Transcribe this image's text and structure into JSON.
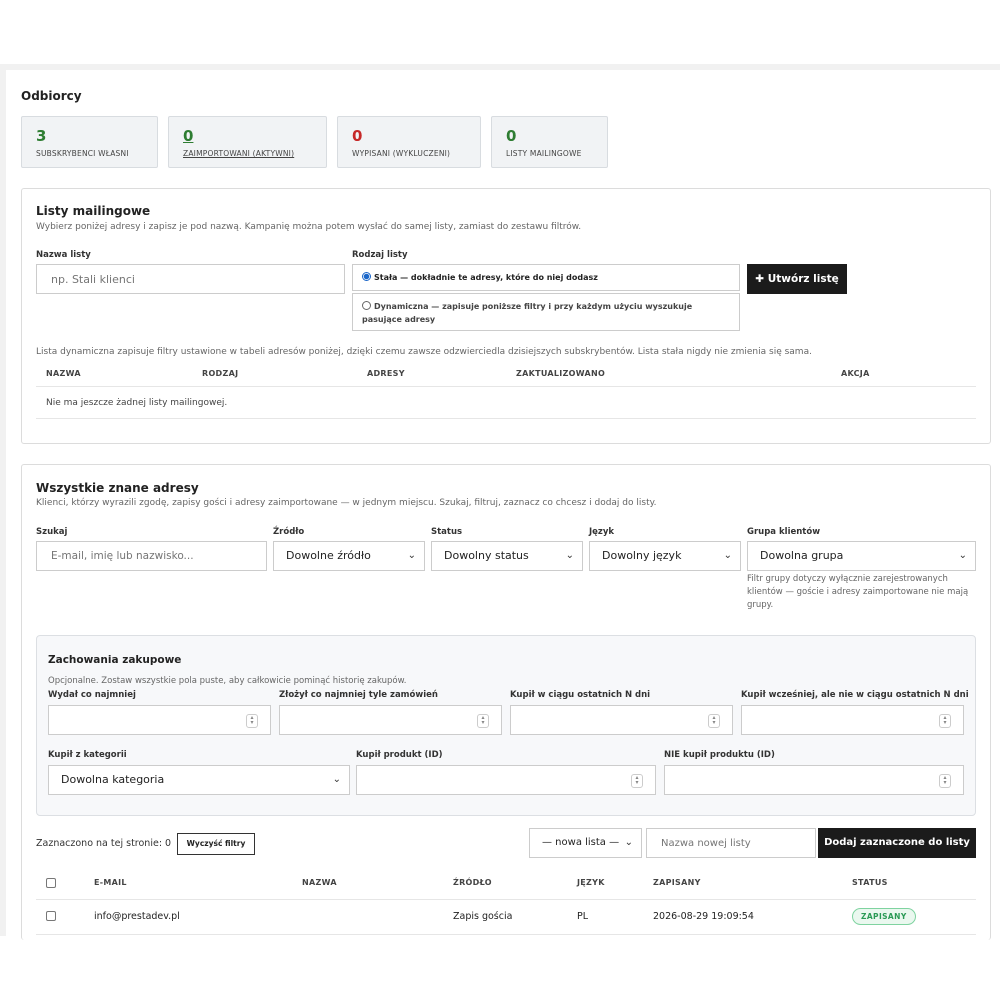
{
  "recipients": {
    "title": "Odbiorcy",
    "stats": [
      {
        "value": "3",
        "label": "SUBSKRYBENCI WŁASNI",
        "color": "#2e7d32"
      },
      {
        "value": "0",
        "label": "ZAIMPORTOWANI (AKTYWNI)",
        "color": "#2e7d32"
      },
      {
        "value": "0",
        "label": "WYPISANI (WYKLUCZENI)",
        "color": "#c62828"
      },
      {
        "value": "0",
        "label": "LISTY MAILINGOWE",
        "color": "#2e7d32"
      }
    ]
  },
  "mailing_lists": {
    "title": "Listy mailingowe",
    "subtitle": "Wybierz poniżej adresy i zapisz je pod nazwą. Kampanię można potem wysłać do samej listy, zamiast do zestawu filtrów.",
    "name_label": "Nazwa listy",
    "name_placeholder": "np. Stali klienci",
    "type_label": "Rodzaj listy",
    "type_static": "Stała — dokładnie te adresy, które do niej dodasz",
    "type_dynamic": "Dynamiczna — zapisuje poniższe filtry i przy każdym użyciu wyszukuje pasujące adresy",
    "create_button": "Utwórz listę",
    "info": "Lista dynamiczna zapisuje filtry ustawione w tabeli adresów poniżej, dzięki czemu zawsze odzwierciedla dzisiejszych subskrybentów. Lista stała nigdy nie zmienia się sama.",
    "columns": [
      "NAZWA",
      "RODZAJ",
      "ADRESY",
      "ZAKTUALIZOWANO",
      "AKCJA"
    ],
    "empty": "Nie ma jeszcze żadnej listy mailingowej."
  },
  "addresses": {
    "title": "Wszystkie znane adresy",
    "subtitle": "Klienci, którzy wyrazili zgodę, zapisy gości i adresy zaimportowane — w jednym miejscu. Szukaj, filtruj, zaznacz co chcesz i dodaj do listy.",
    "search_label": "Szukaj",
    "search_placeholder": "E-mail, imię lub nazwisko...",
    "source_label": "Źródło",
    "source_value": "Dowolne źródło",
    "status_label": "Status",
    "status_value": "Dowolny status",
    "language_label": "Język",
    "language_value": "Dowolny język",
    "group_label": "Grupa klientów",
    "group_value": "Dowolna grupa",
    "group_hint": "Filtr grupy dotyczy wyłącznie zarejestrowanych klientów — goście i adresy zaimportowane nie mają grupy.",
    "purchase": {
      "title": "Zachowania zakupowe",
      "subtitle": "Opcjonalne. Zostaw wszystkie pola puste, aby całkowicie pominąć historię zakupów.",
      "spent_label": "Wydał co najmniej",
      "orders_label": "Złożył co najmniej tyle zamówień",
      "bought_days_label": "Kupił w ciągu ostatnich N dni",
      "bought_before_label": "Kupił wcześniej, ale nie w ciągu ostatnich N dni",
      "category_label": "Kupił z kategorii",
      "category_value": "Dowolna kategoria",
      "product_label": "Kupił produkt (ID)",
      "not_product_label": "NIE kupił produktu (ID)"
    },
    "selected_text": "Zaznaczono na tej stronie: 0",
    "clear_filters": "Wyczyść filtry",
    "new_list_select": "— nowa lista —",
    "new_list_placeholder": "Nazwa nowej listy",
    "add_button": "Dodaj zaznaczone do listy",
    "columns": [
      "E-MAIL",
      "NAZWA",
      "ŹRÓDŁO",
      "JĘZYK",
      "ZAPISANY",
      "STATUS"
    ],
    "rows": [
      {
        "email": "info@prestadev.pl",
        "name": "",
        "source": "Zapis gościa",
        "language": "PL",
        "subscribed": "2026-08-29 19:09:54",
        "status": "ZAPISANY"
      }
    ]
  }
}
